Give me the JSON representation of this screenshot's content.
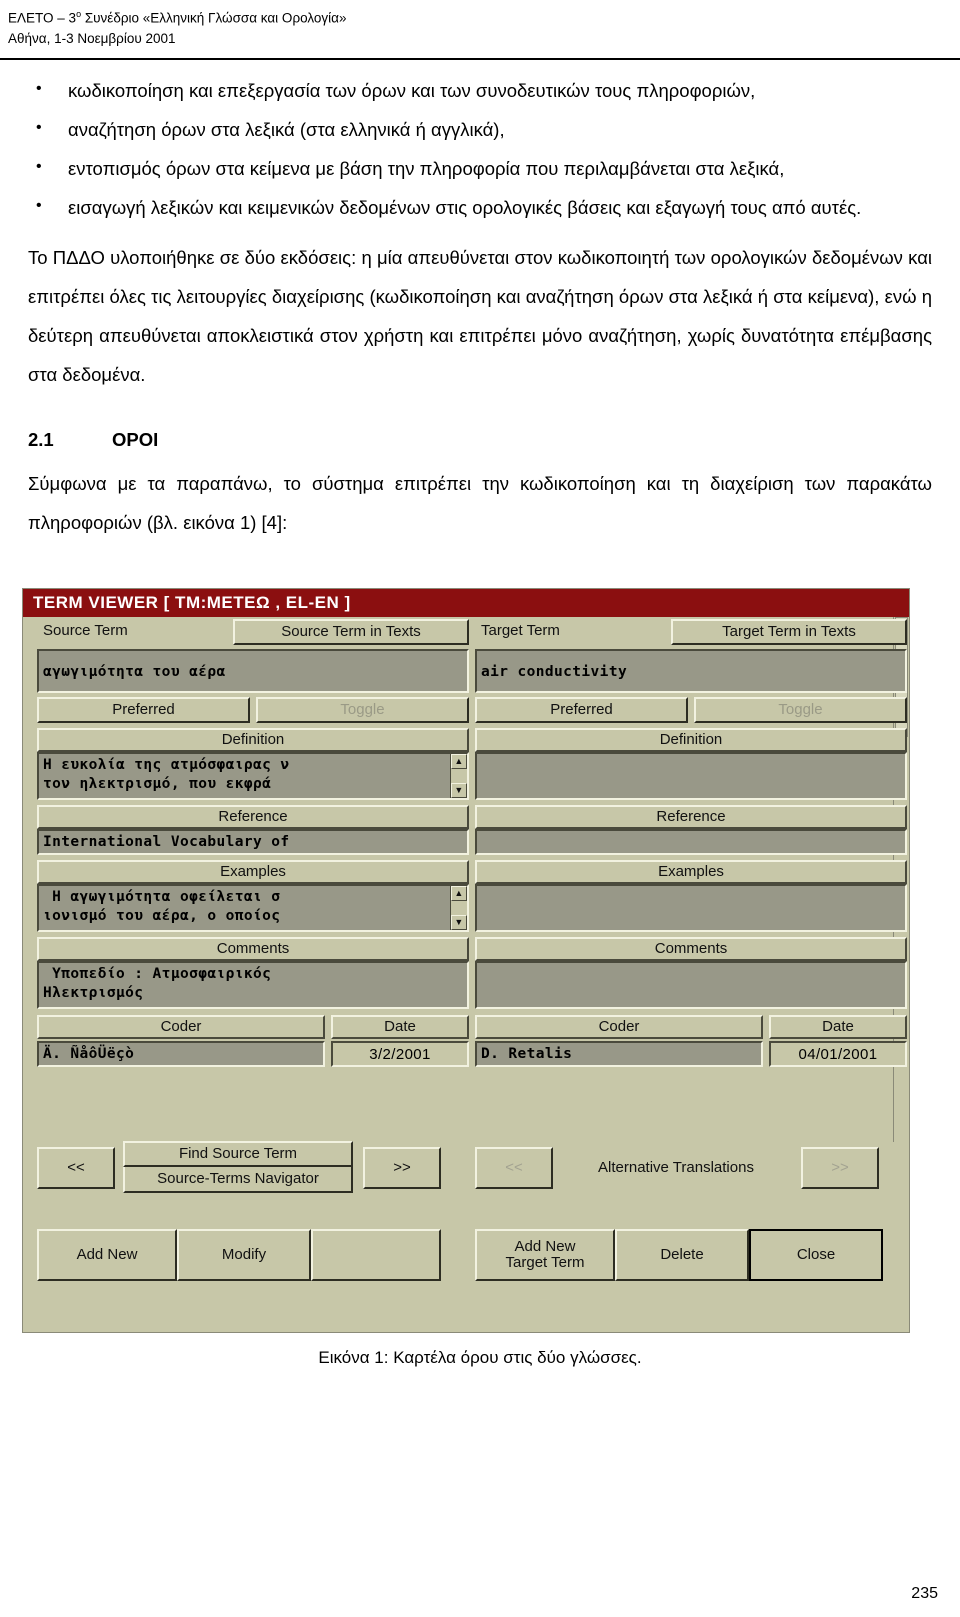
{
  "header": {
    "line1_pre": "ΕΛΕΤΟ – 3",
    "line1_sup": "ο",
    "line1_post": " Συνέδριο «Ελληνική Γλώσσα και Ορολογία»",
    "line2": "Αθήνα, 1-3 Νοεμβρίου 2001"
  },
  "bullets": [
    "κωδικοποίηση και επεξεργασία των όρων και των συνοδευτικών τους πληροφοριών,",
    "αναζήτηση όρων στα λεξικά (στα ελληνικά ή αγγλικά),",
    "εντοπισμός όρων στα κείμενα με βάση την πληροφορία που περιλαμβάνεται στα λεξικά,",
    "εισαγωγή λεξικών και κειμενικών δεδομένων στις ορολογικές βάσεις και εξαγωγή τους από αυτές."
  ],
  "paragraphs": {
    "p1": "Το ΠΔΔΟ υλοποιήθηκε σε δύο εκδόσεις: η μία απευθύνεται στον κωδικοποιητή των ορολογικών δεδομένων και επιτρέπει όλες τις λειτουργίες διαχείρισης (κωδικοποίηση και αναζήτηση όρων στα λεξικά ή στα κείμενα), ενώ η δεύτερη απευθύνεται αποκλειστικά στον χρήστη και επιτρέπει μόνο αναζήτηση, χωρίς δυνατότητα επέμβασης στα δεδομένα.",
    "p2": "Σύμφωνα με τα παραπάνω, το σύστημα επιτρέπει την κωδικοποίηση και τη διαχείριση των παρακάτω πληροφοριών (βλ. εικόνα 1) [4]:"
  },
  "section": {
    "number": "2.1",
    "title": "ΟΡΟΙ"
  },
  "figure": {
    "caption": "Εικόνα 1: Καρτέλα όρου στις δύο γλώσσες.",
    "window": {
      "title": "TERM VIEWER  [ TM:METEΩ , EL-EN ]",
      "titlebar_color": "#8b0f10",
      "face_color": "#c7c7a8",
      "field_color": "#989888"
    },
    "source": {
      "term_label": "Source Term",
      "in_texts_button": "Source Term in Texts",
      "term_value": "αγωγιμότητα του αέρα",
      "preferred_button": "Preferred",
      "toggle_button": "Toggle",
      "definition_label": "Definition",
      "definition_line1": "Η ευκολία της ατμόσφαιρας ν",
      "definition_line2": "τον ηλεκτρισμό, που εκφρά",
      "reference_label": "Reference",
      "reference_value": "International Vocabulary of",
      "examples_label": "Examples",
      "examples_line1": " Η αγωγιμότητα οφείλεται σ",
      "examples_line2": "ιονισμό του αέρα, ο οποίος",
      "comments_label": "Comments",
      "comments_line1": " Υποπεδίο : Ατμοσφαιρικός",
      "comments_line2": "Ηλεκτρισμός",
      "coder_label": "Coder",
      "date_label": "Date",
      "coder_value": "Ä. ÑåôÜëçò",
      "date_value": "3/2/2001"
    },
    "target": {
      "term_label": "Target Term",
      "in_texts_button": "Target Term in Texts",
      "term_value": "air conductivity",
      "preferred_button": "Preferred",
      "toggle_button": "Toggle",
      "definition_label": "Definition",
      "definition_value": "",
      "reference_label": "Reference",
      "reference_value": "",
      "examples_label": "Examples",
      "examples_value": "",
      "comments_label": "Comments",
      "comments_value": "",
      "coder_label": "Coder",
      "date_label": "Date",
      "coder_value": "D. Retalis",
      "date_value": "04/01/2001"
    },
    "nav": {
      "src_prev": "<<",
      "src_find": "Find Source Term",
      "src_navigator": "Source-Terms Navigator",
      "src_next": ">>",
      "tgt_prev": "<<",
      "tgt_alt": "Alternative Translations",
      "tgt_next": ">>"
    },
    "actions": {
      "add_new": "Add New",
      "modify": "Modify",
      "blank": "",
      "add_new_target": "Add New\nTarget Term",
      "delete": "Delete",
      "close": "Close"
    }
  },
  "page_number": "235"
}
